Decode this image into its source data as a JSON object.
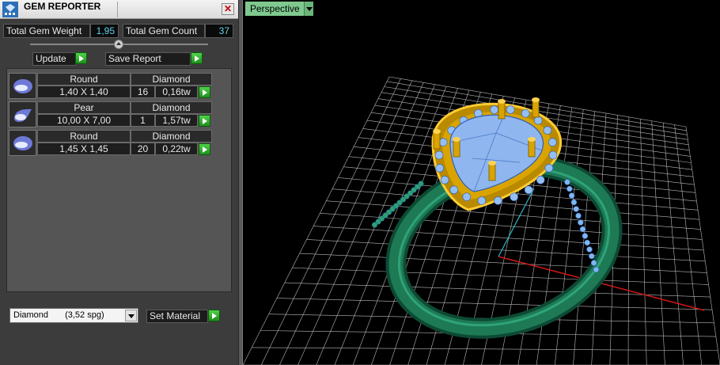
{
  "panel": {
    "title": "GEM REPORTER",
    "close_glyph": "✕",
    "total_weight_label": "Total Gem Weight",
    "total_weight_value": "1,95",
    "total_count_label": "Total Gem Count",
    "total_count_value": "37",
    "update_label": "Update",
    "save_report_label": "Save Report"
  },
  "gems": [
    {
      "shape": "Round",
      "material": "Diamond",
      "size": "1,40 X 1,40",
      "count": "16",
      "weight": "0,16tw",
      "icon": "round-gem-icon"
    },
    {
      "shape": "Pear",
      "material": "Diamond",
      "size": "10,00 X 7,00",
      "count": "1",
      "weight": "1,57tw",
      "icon": "pear-gem-icon"
    },
    {
      "shape": "Round",
      "material": "Diamond",
      "size": "1,45 X 1,45",
      "count": "20",
      "weight": "0,22tw",
      "icon": "round-gem-icon"
    }
  ],
  "material": {
    "selected_name": "Diamond",
    "selected_density": "(3,52 spg)",
    "set_label": "Set Material"
  },
  "viewport": {
    "label": "Perspective"
  },
  "colors": {
    "accent_green": "#2bb52b",
    "value_cyan": "#5ed3e8",
    "viewport_tab": "#7fc98f",
    "ring_metal": "#1d7a55",
    "gold_setting": "#e0a400",
    "gem_blue": "#8fb6ee"
  }
}
